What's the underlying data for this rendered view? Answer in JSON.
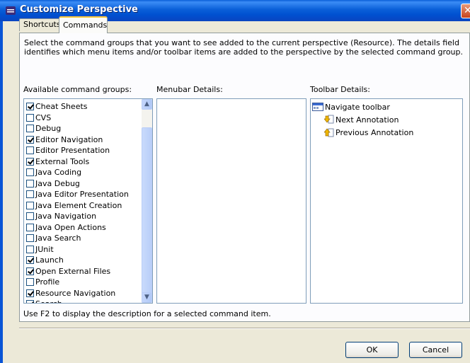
{
  "window": {
    "title": "Customize Perspective"
  },
  "tabs": [
    {
      "label": "Shortcuts"
    },
    {
      "label": "Commands"
    }
  ],
  "description": "Select the command groups that you want to see added to the current perspective (Resource).  The details field identifies which menu items and/or toolbar items are added to the perspective by the selected command group.",
  "labels": {
    "available": "Available command groups:",
    "menubar": "Menubar Details:",
    "toolbar": "Toolbar Details:"
  },
  "command_groups": [
    {
      "label": "Cheat Sheets",
      "checked": true
    },
    {
      "label": "CVS",
      "checked": false
    },
    {
      "label": "Debug",
      "checked": false
    },
    {
      "label": "Editor Navigation",
      "checked": true
    },
    {
      "label": "Editor Presentation",
      "checked": false
    },
    {
      "label": "External Tools",
      "checked": true
    },
    {
      "label": "Java Coding",
      "checked": false
    },
    {
      "label": "Java Debug",
      "checked": false
    },
    {
      "label": "Java Editor Presentation",
      "checked": false
    },
    {
      "label": "Java Element Creation",
      "checked": false
    },
    {
      "label": "Java Navigation",
      "checked": false
    },
    {
      "label": "Java Open Actions",
      "checked": false
    },
    {
      "label": "Java Search",
      "checked": false
    },
    {
      "label": "JUnit",
      "checked": false
    },
    {
      "label": "Launch",
      "checked": true
    },
    {
      "label": "Open External Files",
      "checked": true
    },
    {
      "label": "Profile",
      "checked": false
    },
    {
      "label": "Resource Navigation",
      "checked": true
    },
    {
      "label": "Search",
      "checked": true
    }
  ],
  "toolbar_details": {
    "root": "Navigate toolbar",
    "children": [
      "Next Annotation",
      "Previous Annotation"
    ]
  },
  "hint": "Use F2 to display the description for a selected command item.",
  "buttons": {
    "ok": "OK",
    "cancel": "Cancel"
  }
}
